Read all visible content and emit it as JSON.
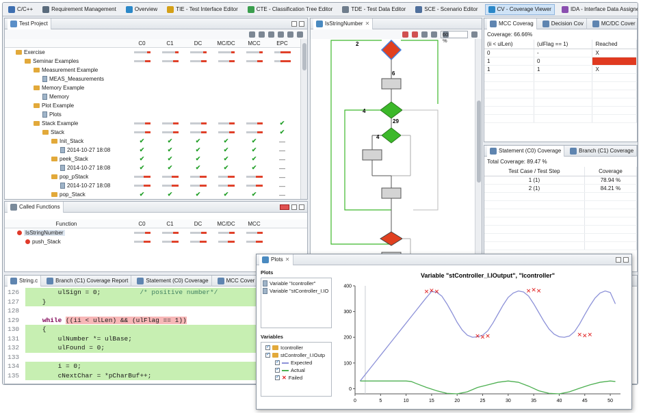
{
  "perspective_tabs": [
    {
      "label": "C/C++",
      "active": false,
      "color": "#3e6fb0"
    },
    {
      "label": "Requirement Management",
      "active": false,
      "color": "#5a6b7c"
    },
    {
      "label": "Overview",
      "active": false,
      "color": "#2b88c8"
    },
    {
      "label": "TIE - Test Interface Editor",
      "active": false,
      "color": "#d4a017"
    },
    {
      "label": "CTE - Classification Tree Editor",
      "active": false,
      "color": "#3a9e4d"
    },
    {
      "label": "TDE - Test Data Editor",
      "active": false,
      "color": "#6f7d8c"
    },
    {
      "label": "SCE - Scenario Editor",
      "active": false,
      "color": "#4f6f9c"
    },
    {
      "label": "CV - Coverage Viewer",
      "active": true,
      "color": "#2b88c8"
    },
    {
      "label": "IDA - Interface Data Assigner",
      "active": false,
      "color": "#8a4fb0"
    }
  ],
  "test_project": {
    "tab_label": "Test Project",
    "columns": [
      "C0",
      "C1",
      "DC",
      "MC/DC",
      "MCC",
      "EPC"
    ],
    "rows": [
      {
        "name": "Exercise",
        "indent": 0,
        "kind": "folder",
        "cells": [
          "b20",
          "b20",
          "b20",
          "b20",
          "b20",
          "b60"
        ]
      },
      {
        "name": "Seminar Examples",
        "indent": 1,
        "kind": "folder",
        "cells": [
          "b30",
          "b30",
          "b30",
          "b30",
          "b30",
          "b60"
        ]
      },
      {
        "name": "Measurement Example",
        "indent": 2,
        "kind": "folder",
        "cells": [
          "",
          "",
          "",
          "",
          "",
          ""
        ]
      },
      {
        "name": "MEAS_Measurements",
        "indent": 3,
        "kind": "file",
        "cells": [
          "",
          "",
          "",
          "",
          "",
          ""
        ]
      },
      {
        "name": "Memory Example",
        "indent": 2,
        "kind": "folder",
        "cells": [
          "",
          "",
          "",
          "",
          "",
          ""
        ]
      },
      {
        "name": "Memory",
        "indent": 3,
        "kind": "file",
        "cells": [
          "",
          "",
          "",
          "",
          "",
          ""
        ]
      },
      {
        "name": "Plot Example",
        "indent": 2,
        "kind": "folder",
        "cells": [
          "",
          "",
          "",
          "",
          "",
          ""
        ]
      },
      {
        "name": "Plots",
        "indent": 3,
        "kind": "file",
        "cells": [
          "",
          "",
          "",
          "",
          "",
          ""
        ]
      },
      {
        "name": "Stack Example",
        "indent": 2,
        "kind": "folder",
        "cells": [
          "b30",
          "b30",
          "b30",
          "b30",
          "b30",
          "chk"
        ]
      },
      {
        "name": "Stack",
        "indent": 3,
        "kind": "folder",
        "cells": [
          "b30",
          "b30",
          "b30",
          "b30",
          "b30",
          "chk"
        ]
      },
      {
        "name": "Init_Stack",
        "indent": 4,
        "kind": "folder",
        "cells": [
          "chk",
          "chk",
          "chk",
          "chk",
          "chk",
          "dash"
        ]
      },
      {
        "name": "2014-10-27 18:08",
        "indent": 5,
        "kind": "file",
        "cells": [
          "chk",
          "chk",
          "chk",
          "chk",
          "chk",
          "dash"
        ]
      },
      {
        "name": "peek_Stack",
        "indent": 4,
        "kind": "folder",
        "cells": [
          "chk",
          "chk",
          "chk",
          "chk",
          "chk",
          "dash"
        ]
      },
      {
        "name": "2014-10-27 18:08",
        "indent": 5,
        "kind": "file",
        "cells": [
          "chk",
          "chk",
          "chk",
          "chk",
          "chk",
          "dash"
        ]
      },
      {
        "name": "pop_pStack",
        "indent": 4,
        "kind": "folder",
        "cells": [
          "b40",
          "b40",
          "b40",
          "b40",
          "b40",
          "dash"
        ]
      },
      {
        "name": "2014-10-27 18:08",
        "indent": 5,
        "kind": "file",
        "cells": [
          "b40",
          "b40",
          "b40",
          "b40",
          "b40",
          "dash"
        ]
      },
      {
        "name": "pop_Stack",
        "indent": 4,
        "kind": "folder",
        "cells": [
          "chk",
          "chk",
          "chk",
          "chk",
          "chk",
          "dash"
        ]
      }
    ]
  },
  "called_functions": {
    "tab_label": "Called Functions",
    "columns": [
      "Function",
      "C0",
      "C1",
      "DC",
      "MC/DC",
      "MCC"
    ],
    "rows": [
      {
        "name": "IsStringNumber",
        "selected": true,
        "cells": [
          "b30",
          "b30",
          "b30",
          "b30",
          "b30"
        ]
      },
      {
        "name": "push_Stack",
        "selected": false,
        "cells": [
          "b40",
          "b40",
          "b40",
          "b40",
          "b40"
        ]
      }
    ]
  },
  "flow_graph": {
    "tab_label": "IsStringNumber",
    "zoom": "60 %",
    "labels": {
      "a": "2",
      "b": "6",
      "c": "4",
      "d": "29",
      "e": "4"
    }
  },
  "mcc": {
    "tabs": [
      "MCC Coverag",
      "Decision Cov",
      "MC/DC Cover"
    ],
    "coverage": "Coverage: 66.66%",
    "columns": [
      "(ii < ulLen)",
      "(ulFlag == 1)",
      "Reached"
    ],
    "rows": [
      {
        "a": "0",
        "b": "-",
        "r": "X",
        "hit": false
      },
      {
        "a": "1",
        "b": "0",
        "r": "",
        "hit": true
      },
      {
        "a": "1",
        "b": "1",
        "r": "X",
        "hit": false
      }
    ]
  },
  "statement": {
    "tabs": [
      "Statement (C0) Coverage",
      "Branch (C1) Coverage"
    ],
    "total": "Total Coverage: 89.47 %",
    "columns": [
      "Test Case / Test Step",
      "Coverage"
    ],
    "rows": [
      {
        "step": "1 (1)",
        "cov": "78.94 %"
      },
      {
        "step": "2 (1)",
        "cov": "84.21 %"
      }
    ]
  },
  "editor": {
    "tabs": [
      "String.c",
      "Branch (C1) Coverage Report",
      "Statement (C0) Coverage",
      "MCC Cover"
    ],
    "lines": [
      {
        "n": "126",
        "hl": "green",
        "parts": [
          {
            "t": "        ulSign = 0;          ",
            "c": ""
          },
          {
            "t": "/* positive number*/",
            "c": "cm"
          }
        ]
      },
      {
        "n": "127",
        "hl": "green",
        "parts": [
          {
            "t": "    }",
            "c": ""
          }
        ]
      },
      {
        "n": "128",
        "hl": "",
        "parts": [
          {
            "t": "",
            "c": ""
          }
        ]
      },
      {
        "n": "129",
        "hl": "",
        "parts": [
          {
            "t": "    ",
            "c": ""
          },
          {
            "t": "while",
            "c": "kw"
          },
          {
            "t": " ",
            "c": ""
          },
          {
            "t": "((ii < ulLen) && (ulFlag == 1))",
            "c": "hl-red"
          }
        ]
      },
      {
        "n": "130",
        "hl": "green",
        "parts": [
          {
            "t": "    {",
            "c": ""
          }
        ]
      },
      {
        "n": "131",
        "hl": "green",
        "parts": [
          {
            "t": "        ulNumber *= ulBase;",
            "c": ""
          }
        ]
      },
      {
        "n": "132",
        "hl": "green",
        "parts": [
          {
            "t": "        ulFound = 0;",
            "c": ""
          }
        ]
      },
      {
        "n": "133",
        "hl": "",
        "parts": [
          {
            "t": "",
            "c": ""
          }
        ]
      },
      {
        "n": "134",
        "hl": "green",
        "parts": [
          {
            "t": "        i = 0;",
            "c": ""
          }
        ]
      },
      {
        "n": "135",
        "hl": "green",
        "parts": [
          {
            "t": "        cNextChar = *pCharBuf++;",
            "c": ""
          }
        ]
      }
    ]
  },
  "plots": {
    "tab_label": "Plots",
    "plots_header": "Plots",
    "plot_items": [
      "Variable \"Icontroller\"",
      "Variable \"stController_I.IO"
    ],
    "variables_header": "Variables",
    "variables": [
      {
        "label": "Icontroller",
        "level": 0
      },
      {
        "label": "stController_I.IOutp",
        "level": 0
      },
      {
        "label": "Expected",
        "level": 1,
        "color": "#8c91d8"
      },
      {
        "label": "Actual",
        "level": 1,
        "color": "#4caf50"
      },
      {
        "label": "Failed",
        "level": 1,
        "color": "#e02020"
      }
    ]
  },
  "chart_data": {
    "type": "line",
    "title": "Variable \"stController_I.IOutput\", \"Icontroller\"",
    "xlim": [
      0,
      52
    ],
    "ylim": [
      -20,
      400
    ],
    "xticks": [
      0,
      5,
      10,
      15,
      20,
      25,
      30,
      35,
      40,
      45,
      50
    ],
    "yticks": [
      0,
      100,
      200,
      300,
      400
    ],
    "series": [
      {
        "name": "Expected",
        "color": "#8c91d8",
        "x": [
          1,
          2,
          3,
          4,
          5,
          6,
          7,
          8,
          9,
          10,
          11,
          12,
          13,
          14,
          15,
          16,
          17,
          18,
          19,
          20,
          21,
          22,
          23,
          24,
          25,
          26,
          27,
          28,
          29,
          30,
          31,
          32,
          33,
          34,
          35,
          36,
          37,
          38,
          39,
          40,
          41,
          42,
          43,
          44,
          45,
          46,
          47,
          48,
          49,
          50,
          51
        ],
        "values": [
          30,
          55,
          80,
          105,
          130,
          155,
          180,
          205,
          230,
          255,
          280,
          305,
          330,
          355,
          378,
          375,
          360,
          330,
          295,
          258,
          228,
          208,
          200,
          202,
          208,
          225,
          255,
          290,
          325,
          355,
          372,
          380,
          376,
          360,
          330,
          296,
          262,
          232,
          212,
          202,
          200,
          205,
          222,
          252,
          288,
          322,
          352,
          372,
          380,
          374,
          330
        ]
      },
      {
        "name": "Actual",
        "color": "#4caf50",
        "x": [
          1,
          5,
          10,
          11,
          12,
          14,
          16,
          18,
          20,
          22,
          24,
          26,
          28,
          30,
          32,
          34,
          36,
          38,
          40,
          42,
          44,
          46,
          48,
          50,
          51
        ],
        "values": [
          30,
          30,
          30,
          28,
          20,
          5,
          -8,
          -18,
          -20,
          -12,
          5,
          15,
          25,
          30,
          25,
          10,
          -8,
          -18,
          -20,
          -12,
          2,
          15,
          25,
          30,
          28
        ]
      },
      {
        "name": "Failed",
        "color": "#e02020",
        "x": [
          14,
          15,
          16,
          24,
          25,
          26,
          34,
          35,
          36,
          44,
          45,
          46
        ],
        "values": [
          378,
          382,
          378,
          204,
          200,
          204,
          380,
          384,
          380,
          210,
          206,
          210
        ]
      }
    ]
  }
}
